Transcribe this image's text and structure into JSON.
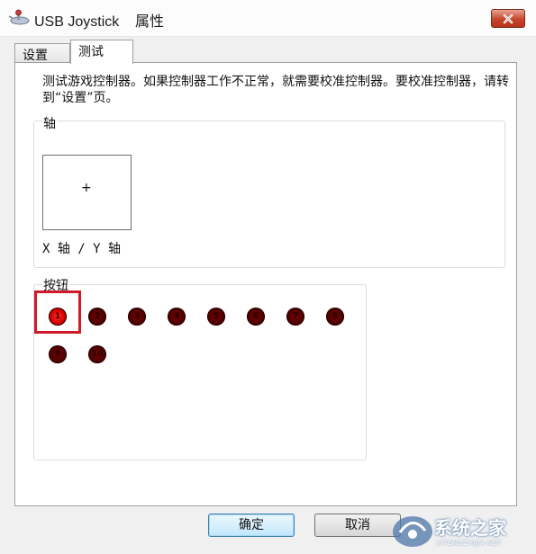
{
  "window": {
    "title_app": "USB Joystick",
    "title_suffix": "属性"
  },
  "tabs": [
    {
      "label": "设置",
      "active": false
    },
    {
      "label": "测试",
      "active": true
    }
  ],
  "test_page": {
    "description": "测试游戏控制器。如果控制器工作不正常，就需要校准控制器。要校准控制器，请转到“设置”页。",
    "axes": {
      "label": "轴",
      "crosshair": "+",
      "caption": "X 轴 / Y 轴"
    },
    "buttons": {
      "label": "按钮",
      "items": [
        {
          "number": "1",
          "pressed": true
        },
        {
          "number": "2",
          "pressed": false
        },
        {
          "number": "3",
          "pressed": false
        },
        {
          "number": "4",
          "pressed": false
        },
        {
          "number": "5",
          "pressed": false
        },
        {
          "number": "6",
          "pressed": false
        },
        {
          "number": "7",
          "pressed": false
        },
        {
          "number": "8",
          "pressed": false
        },
        {
          "number": "9",
          "pressed": false
        },
        {
          "number": "10",
          "pressed": false
        }
      ]
    }
  },
  "footer": {
    "ok_label": "确定",
    "cancel_label": "取消"
  },
  "watermark": {
    "brand": "系统之家",
    "url": "XITONGZHIJIA.NET"
  },
  "colors": {
    "highlight": "#d01a2a",
    "button_lit": "#e00000",
    "button_idle": "#5a0000",
    "close_button": "#c5472c"
  }
}
